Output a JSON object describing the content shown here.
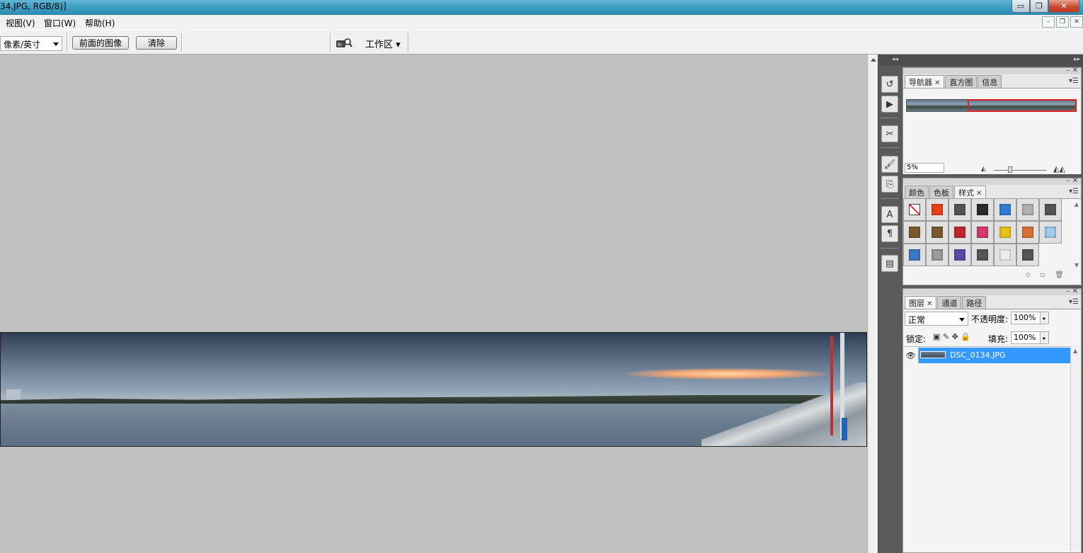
{
  "window": {
    "title": "34.JPG, RGB/8)]",
    "min_glyph": "▭",
    "max_glyph": "❐",
    "close_glyph": "✕"
  },
  "menu": {
    "items": [
      "视图(V)",
      "窗口(W)",
      "帮助(H)"
    ],
    "doc_min": "–",
    "doc_restore": "❐",
    "doc_close": "✕"
  },
  "options": {
    "resolution_unit": "像素/英寸",
    "front_image_button": "前面的图像",
    "clear_button": "清除",
    "workspace_label": "工作区 ▾"
  },
  "dock": {
    "collapse_glyph": "◂◂",
    "expand_glyph": "▸▸",
    "icons": [
      "history-icon",
      "actions-icon",
      "tool-presets-icon",
      "brushes-icon",
      "clone-source-icon",
      "character-icon",
      "paragraph-icon",
      "layer-comps-icon"
    ],
    "icon_glyphs": [
      "↺",
      "▶",
      "✂",
      "🖌",
      "⎘",
      "A",
      "¶",
      "▤"
    ]
  },
  "navigator_panel": {
    "tabs": [
      {
        "label": "导航器",
        "closable": true
      },
      {
        "label": "直方图",
        "closable": false
      },
      {
        "label": "信息",
        "closable": false
      }
    ],
    "zoom_value": "5%",
    "viewport_fraction": 0.64
  },
  "styles_panel": {
    "tabs": [
      {
        "label": "颜色",
        "closable": false
      },
      {
        "label": "色板",
        "closable": false
      },
      {
        "label": "样式",
        "closable": true
      }
    ],
    "swatch_colors": [
      "#ffffff",
      "#e8421a",
      "#555555",
      "#2b2b2b",
      "#2f7fd6",
      "#b0b0b0",
      "#555555",
      "#7a5a2e",
      "#7a5a2e",
      "#c0282d",
      "#d63a6a",
      "#e8c21a",
      "#d8733a",
      "#9fc9ec",
      "#3b78c8",
      "#9a9a9a",
      "#5a4aa8",
      "#555555",
      "#eeeeee",
      "#555555"
    ]
  },
  "layers_panel": {
    "tabs": [
      {
        "label": "图层",
        "closable": true
      },
      {
        "label": "通道",
        "closable": false
      },
      {
        "label": "路径",
        "closable": false
      }
    ],
    "blend_mode": "正常",
    "opacity_label": "不透明度:",
    "opacity_value": "100%",
    "lock_label": "锁定:",
    "fill_label": "填充:",
    "fill_value": "100%",
    "lock_glyphs": "▣ ✎ ✥ 🔒",
    "layer_name": "DSC_0134.JPG"
  },
  "colors": {
    "titlebar": "#3c9cc2",
    "canvas_bg": "#c0c0c0",
    "dock_bg": "#5a5a5a",
    "layer_selected": "#3399ff",
    "navigator_view_box": "#e02020"
  }
}
